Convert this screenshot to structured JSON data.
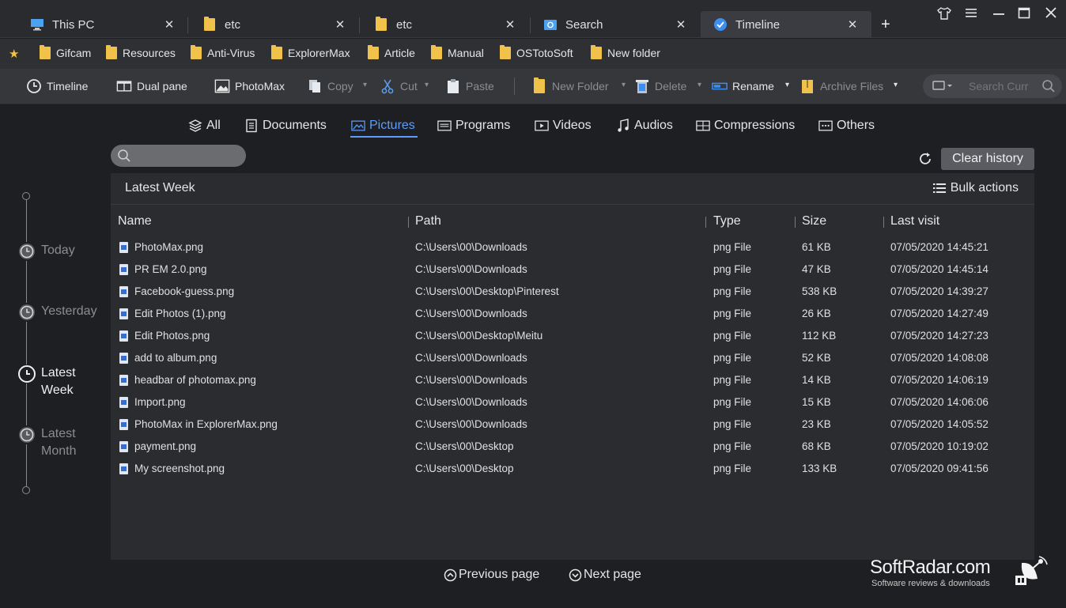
{
  "tabs": [
    {
      "label": "This PC",
      "icon": "computer-icon"
    },
    {
      "label": "etc",
      "icon": "folder-icon"
    },
    {
      "label": "etc",
      "icon": "folder-icon"
    },
    {
      "label": "Search",
      "icon": "search-folder-icon"
    },
    {
      "label": "Timeline",
      "icon": "timeline-icon",
      "active": true
    }
  ],
  "tab_close_glyph": "✕",
  "new_tab_glyph": "+",
  "window_controls": {
    "skin": "shirt-icon",
    "menu": "menu-icon",
    "minimize": "minimize-icon",
    "maximize": "maximize-icon",
    "close": "close-icon"
  },
  "favorites": [
    "Gifcam",
    "Resources",
    "Anti-Virus",
    "ExplorerMax",
    "Article",
    "Manual",
    "OSTotoSoft",
    "New folder"
  ],
  "toolbar": {
    "timeline": "Timeline",
    "dual_pane": "Dual pane",
    "photomax": "PhotoMax",
    "copy": "Copy",
    "cut": "Cut",
    "paste": "Paste",
    "new_folder": "New Folder",
    "delete": "Delete",
    "rename": "Rename",
    "archive_files": "Archive Files",
    "search_placeholder": "Search Curr"
  },
  "categories": [
    "All",
    "Documents",
    "Pictures",
    "Programs",
    "Videos",
    "Audios",
    "Compressions",
    "Others"
  ],
  "active_category": "Pictures",
  "clear_history": "Clear history",
  "timeline_nav": {
    "today": "Today",
    "yesterday": "Yesterday",
    "latest_week": [
      "Latest",
      "Week"
    ],
    "latest_month": [
      "Latest",
      "Month"
    ],
    "active": "Latest Week"
  },
  "panel": {
    "title": "Latest Week",
    "bulk_actions": "Bulk actions",
    "columns": {
      "name": "Name",
      "path": "Path",
      "type": "Type",
      "size": "Size",
      "last_visit": "Last visit"
    },
    "rows": [
      {
        "name": "PhotoMax.png",
        "path": "C:\\Users\\00\\Downloads",
        "type": "png File",
        "size": "61 KB",
        "last_visit": "07/05/2020 14:45:21"
      },
      {
        "name": "PR EM 2.0.png",
        "path": "C:\\Users\\00\\Downloads",
        "type": "png File",
        "size": "47 KB",
        "last_visit": "07/05/2020 14:45:14"
      },
      {
        "name": "Facebook-guess.png",
        "path": "C:\\Users\\00\\Desktop\\Pinterest",
        "type": "png File",
        "size": "538 KB",
        "last_visit": "07/05/2020 14:39:27"
      },
      {
        "name": "Edit Photos (1).png",
        "path": "C:\\Users\\00\\Downloads",
        "type": "png File",
        "size": "26 KB",
        "last_visit": "07/05/2020 14:27:49"
      },
      {
        "name": "Edit Photos.png",
        "path": "C:\\Users\\00\\Desktop\\Meitu",
        "type": "png File",
        "size": "112 KB",
        "last_visit": "07/05/2020 14:27:23"
      },
      {
        "name": "add to album.png",
        "path": "C:\\Users\\00\\Downloads",
        "type": "png File",
        "size": "52 KB",
        "last_visit": "07/05/2020 14:08:08"
      },
      {
        "name": "headbar of photomax.png",
        "path": "C:\\Users\\00\\Downloads",
        "type": "png File",
        "size": "14 KB",
        "last_visit": "07/05/2020 14:06:19"
      },
      {
        "name": "Import.png",
        "path": "C:\\Users\\00\\Downloads",
        "type": "png File",
        "size": "15 KB",
        "last_visit": "07/05/2020 14:06:06"
      },
      {
        "name": "PhotoMax in ExplorerMax.png",
        "path": "C:\\Users\\00\\Downloads",
        "type": "png File",
        "size": "23 KB",
        "last_visit": "07/05/2020 14:05:52"
      },
      {
        "name": "payment.png",
        "path": "C:\\Users\\00\\Desktop",
        "type": "png File",
        "size": "68 KB",
        "last_visit": "07/05/2020 10:19:02"
      },
      {
        "name": "My screenshot.png",
        "path": "C:\\Users\\00\\Desktop",
        "type": "png File",
        "size": "133 KB",
        "last_visit": "07/05/2020 09:41:56"
      }
    ]
  },
  "pager": {
    "previous": "Previous page",
    "next": "Next page"
  },
  "watermark": {
    "title": "SoftRadar.com",
    "subtitle": "Software reviews & downloads"
  },
  "colors": {
    "accent": "#5c9cff",
    "folder": "#f0c24a",
    "star": "#f4c43a",
    "background": "#1e1f22",
    "panel": "#2b2c30"
  }
}
